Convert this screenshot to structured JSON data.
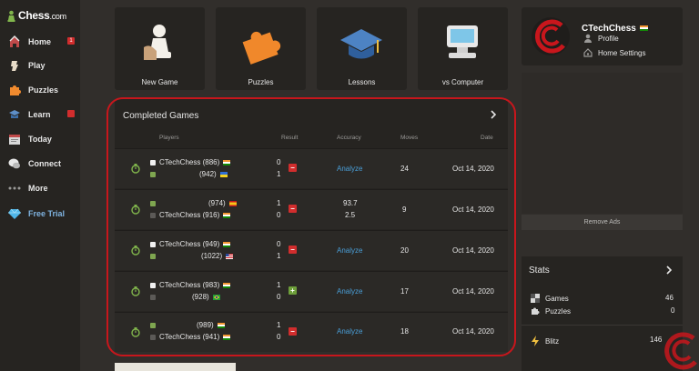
{
  "brand": {
    "name": "Chess",
    "suffix": ".com"
  },
  "sidebar": {
    "items": [
      {
        "label": "Home",
        "icon": "home-icon",
        "badge": "1"
      },
      {
        "label": "Play",
        "icon": "play-icon"
      },
      {
        "label": "Puzzles",
        "icon": "puzzles-icon"
      },
      {
        "label": "Learn",
        "icon": "learn-icon",
        "badge": ""
      },
      {
        "label": "Today",
        "icon": "today-icon"
      },
      {
        "label": "Connect",
        "icon": "connect-icon"
      },
      {
        "label": "More",
        "icon": "more-icon"
      },
      {
        "label": "Free Trial",
        "icon": "diamond-icon"
      }
    ]
  },
  "tiles": [
    {
      "label": "New Game",
      "icon": "pawn-hand-icon"
    },
    {
      "label": "Puzzles",
      "icon": "puzzle-piece-icon"
    },
    {
      "label": "Lessons",
      "icon": "graduation-cap-icon"
    },
    {
      "label": "vs Computer",
      "icon": "computer-icon"
    }
  ],
  "profile": {
    "username": "CTechChess",
    "links": [
      {
        "label": "Profile",
        "icon": "user-icon"
      },
      {
        "label": "Home Settings",
        "icon": "home-settings-icon"
      }
    ]
  },
  "completed_games": {
    "title": "Completed Games",
    "columns": [
      "Players",
      "Result",
      "Accuracy",
      "Moves",
      "Date"
    ],
    "rows": [
      {
        "p1": {
          "name": "CTechChess",
          "rating": "(886)",
          "color": "white",
          "flag": "india"
        },
        "p2": {
          "name": "",
          "rating": "(942)",
          "color": "green",
          "flag": "ukraine"
        },
        "score1": "0",
        "score2": "1",
        "result": "loss",
        "accuracy": "Analyze",
        "moves": "24",
        "date": "Oct 14, 2020"
      },
      {
        "p1": {
          "name": "",
          "rating": "(974)",
          "color": "green",
          "flag": "spain"
        },
        "p2": {
          "name": "CTechChess",
          "rating": "(916)",
          "color": "black",
          "flag": "india"
        },
        "score1": "1",
        "score2": "0",
        "result": "loss",
        "accuracy1": "93.7",
        "accuracy2": "2.5",
        "moves": "9",
        "date": "Oct 14, 2020"
      },
      {
        "p1": {
          "name": "CTechChess",
          "rating": "(949)",
          "color": "white",
          "flag": "india"
        },
        "p2": {
          "name": "",
          "rating": "(1022)",
          "color": "green",
          "flag": "usa"
        },
        "score1": "0",
        "score2": "1",
        "result": "loss",
        "accuracy": "Analyze",
        "moves": "20",
        "date": "Oct 14, 2020"
      },
      {
        "p1": {
          "name": "CTechChess",
          "rating": "(983)",
          "color": "white",
          "flag": "india"
        },
        "p2": {
          "name": "",
          "rating": "(928)",
          "color": "black",
          "flag": "brazil"
        },
        "score1": "1",
        "score2": "0",
        "result": "win",
        "accuracy": "Analyze",
        "moves": "17",
        "date": "Oct 14, 2020"
      },
      {
        "p1": {
          "name": "",
          "rating": "(989)",
          "color": "green",
          "flag": "india"
        },
        "p2": {
          "name": "CTechChess",
          "rating": "(941)",
          "color": "black",
          "flag": "india"
        },
        "score1": "1",
        "score2": "0",
        "result": "loss",
        "accuracy": "Analyze",
        "moves": "18",
        "date": "Oct 14, 2020"
      }
    ]
  },
  "ads": {
    "remove_label": "Remove Ads"
  },
  "stats": {
    "title": "Stats",
    "items": [
      {
        "label": "Games",
        "value": "46",
        "icon": "board-icon"
      },
      {
        "label": "Puzzles",
        "value": "0",
        "icon": "puzzle-small-icon"
      },
      {
        "label": "Blitz",
        "value": "146",
        "icon": "lightning-icon"
      }
    ]
  },
  "colors": {
    "loss": "#d12d2d",
    "win": "#6e9f3a",
    "link": "#4a9fd8",
    "highlight": "#c8161c"
  }
}
